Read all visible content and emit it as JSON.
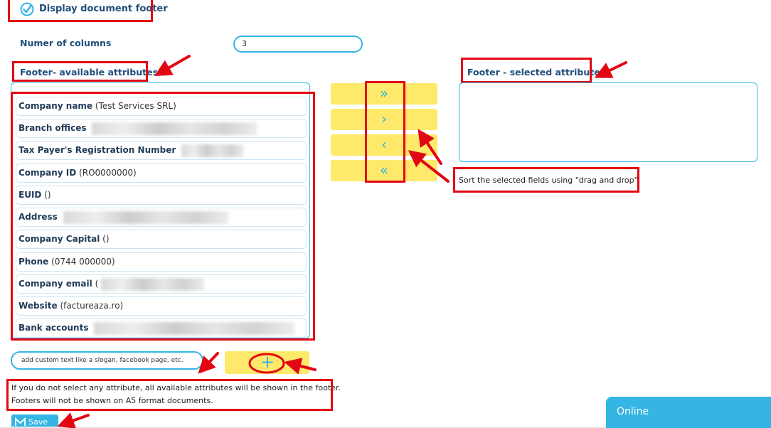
{
  "footer_toggle": {
    "label": "Display document footer",
    "checked": true
  },
  "columns": {
    "label": "Numer of columns",
    "value": "3"
  },
  "available": {
    "title": "Footer- available attributes",
    "items": [
      {
        "name": "Company name",
        "value": "(Test Services SRL)"
      },
      {
        "name": "Branch offices",
        "value": ""
      },
      {
        "name": "Tax Payer's Registration Number",
        "value": ""
      },
      {
        "name": "Company ID",
        "value": "(RO0000000)"
      },
      {
        "name": "EUID",
        "value": "()"
      },
      {
        "name": "Address",
        "value": ""
      },
      {
        "name": "Company Capital",
        "value": "()"
      },
      {
        "name": "Phone",
        "value": "(0744 000000)"
      },
      {
        "name": "Company email",
        "value": "("
      },
      {
        "name": "Website",
        "value": "(factureaza.ro)"
      },
      {
        "name": "Bank accounts",
        "value": ""
      }
    ]
  },
  "move_buttons": {
    "add_all": "»",
    "add_one": "›",
    "remove_one": "‹",
    "remove_all": "«"
  },
  "selected": {
    "title": "Footer - selected attributes"
  },
  "sort_note": "Sort the selected fields using \"drag and drop\"",
  "custom_text": {
    "placeholder": "add custom text like a slogan, facebook page, etc."
  },
  "add_button": {
    "icon": "plus-icon",
    "glyph": "+"
  },
  "info": {
    "line1": "If you do not select any attribute, all available attributes will be shown in the footer.",
    "line2": "Footers will not be shown on A5 format documents."
  },
  "save_button": {
    "label": "Save",
    "icon": "save-icon"
  },
  "chat_widget": {
    "label": "Online"
  },
  "colors": {
    "accent": "#34b5e4",
    "button_yellow": "#ffe96a",
    "annotation_red": "#e30613",
    "label_blue": "#1f4d7a"
  }
}
